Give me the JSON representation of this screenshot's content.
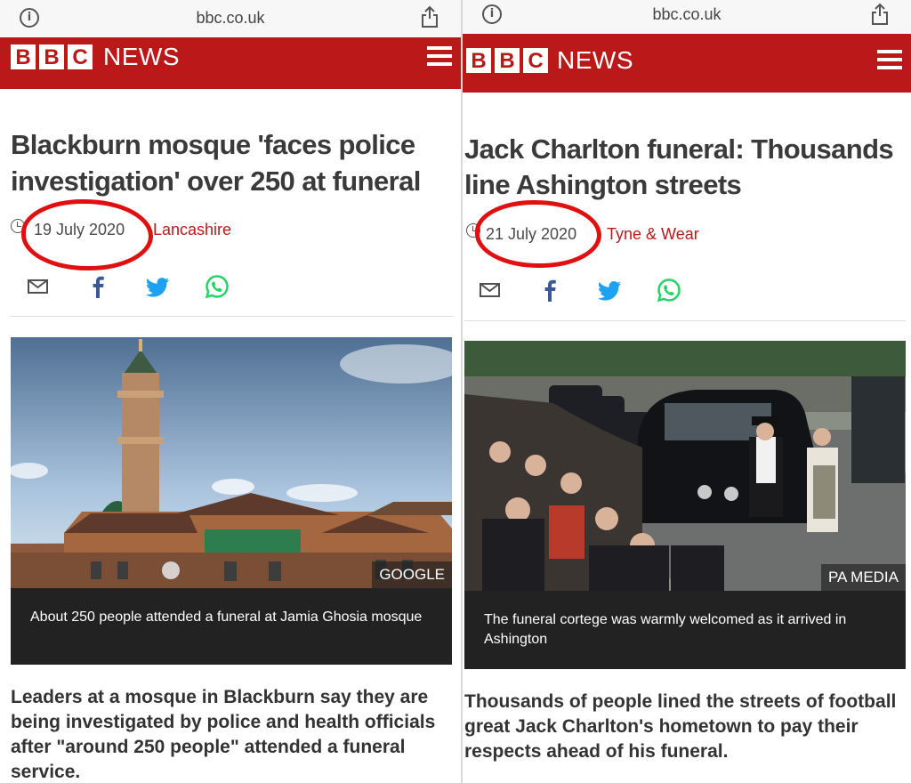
{
  "left": {
    "url": "bbc.co.uk",
    "logo_letters": [
      "B",
      "B",
      "C"
    ],
    "brand": "NEWS",
    "headline": "Blackburn mosque 'faces police investigation' over 250 at funeral",
    "date": "19 July 2020",
    "region": "Lancashire",
    "share_icons": [
      "email-icon",
      "facebook-icon",
      "twitter-icon",
      "whatsapp-icon"
    ],
    "photo_credit": "GOOGLE",
    "caption": "About 250 people attended a funeral at Jamia Ghosia mosque",
    "intro": "Leaders at a mosque in Blackburn say they are being investigated by police and health officials after \"around 250 people\" attended a funeral service."
  },
  "right": {
    "url": "bbc.co.uk",
    "logo_letters": [
      "B",
      "B",
      "C"
    ],
    "brand": "NEWS",
    "headline": "Jack Charlton funeral: Thousands line Ashington streets",
    "date": "21 July 2020",
    "region": "Tyne & Wear",
    "share_icons": [
      "email-icon",
      "facebook-icon",
      "twitter-icon",
      "whatsapp-icon"
    ],
    "photo_credit": "PA MEDIA",
    "caption": "The funeral cortege was warmly welcomed as it arrived in Ashington",
    "intro": "Thousands of people lined the streets of football great Jack Charlton's hometown to pay their respects ahead of his funeral."
  },
  "colors": {
    "bbc_red": "#bb1919",
    "annotation_red": "#e01010",
    "facebook": "#3b5998",
    "twitter": "#1da1f2",
    "whatsapp": "#25d366"
  }
}
